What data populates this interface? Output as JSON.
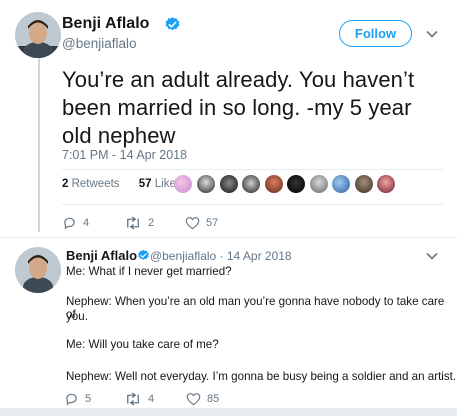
{
  "main_tweet": {
    "author_name": "Benji Aflalo",
    "author_handle": "@benjiaflalo",
    "follow_label": "Follow",
    "text": "You’re an adult already. You haven’t been married in so long. -my 5 year old nephew",
    "timestamp": "7:01 PM - 14 Apr 2018",
    "retweets_count": "2",
    "retweets_label": "Retweets",
    "likes_count": "57",
    "likes_label": "Likes",
    "actions": {
      "replies": "4",
      "retweets": "2",
      "likes": "57"
    }
  },
  "reply_tweet": {
    "author_name": "Benji Aflalo",
    "author_handle": "@benjiaflalo · 14 Apr 2018",
    "lines": [
      "Me: What if I never get married?",
      "Nephew: When you’re an old man you’re gonna have nobody to take care of",
      "you.",
      "Me: Will you take care of me?",
      "Nephew: Well not everyday. I’m gonna be busy being a soldier and an artist."
    ],
    "actions": {
      "replies": "5",
      "retweets": "4",
      "likes": "85"
    }
  },
  "colors": {
    "accent": "#1da1f2",
    "muted": "#657786",
    "divider": "#e6ecf0",
    "thread_line": "#ccd6dd"
  },
  "icons": [
    "verified-badge-icon",
    "chevron-down-icon",
    "reply-icon",
    "retweet-icon",
    "like-icon"
  ]
}
